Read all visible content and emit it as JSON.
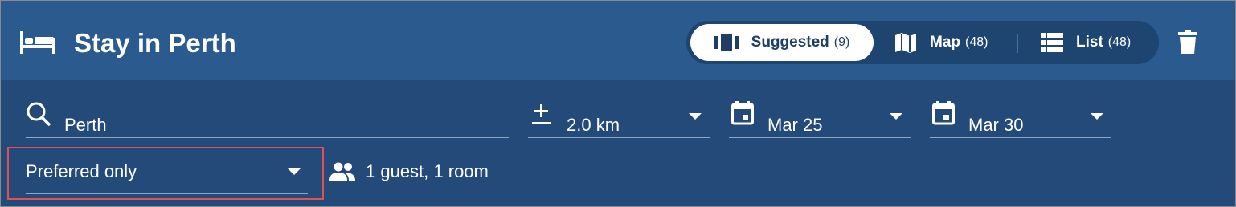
{
  "header": {
    "title": "Stay in Perth",
    "title_icon": "bed-icon",
    "view_toggle": {
      "suggested": {
        "label": "Suggested",
        "count": "(9)",
        "icon": "carousel-icon",
        "selected": true
      },
      "map": {
        "label": "Map",
        "count": "(48)",
        "icon": "map-icon"
      },
      "list": {
        "label": "List",
        "count": "(48)",
        "icon": "list-icon"
      }
    },
    "delete_icon": "trash-icon"
  },
  "filters": {
    "location": {
      "value": "Perth",
      "icon": "search-icon"
    },
    "radius": {
      "value": "2.0 km",
      "icon": "plus-minus-icon"
    },
    "check_in": {
      "value": "Mar 25",
      "icon": "calendar-icon"
    },
    "check_out": {
      "value": "Mar 30",
      "icon": "calendar-icon"
    },
    "preference": {
      "value": "Preferred only"
    },
    "guests": {
      "value": "1 guest, 1 room",
      "icon": "people-icon"
    }
  },
  "colors": {
    "header_bg": "#2a5a8e",
    "filters_bg": "#234a78",
    "selected_segment_bg": "#ffffff",
    "highlight_border": "#e05055"
  }
}
